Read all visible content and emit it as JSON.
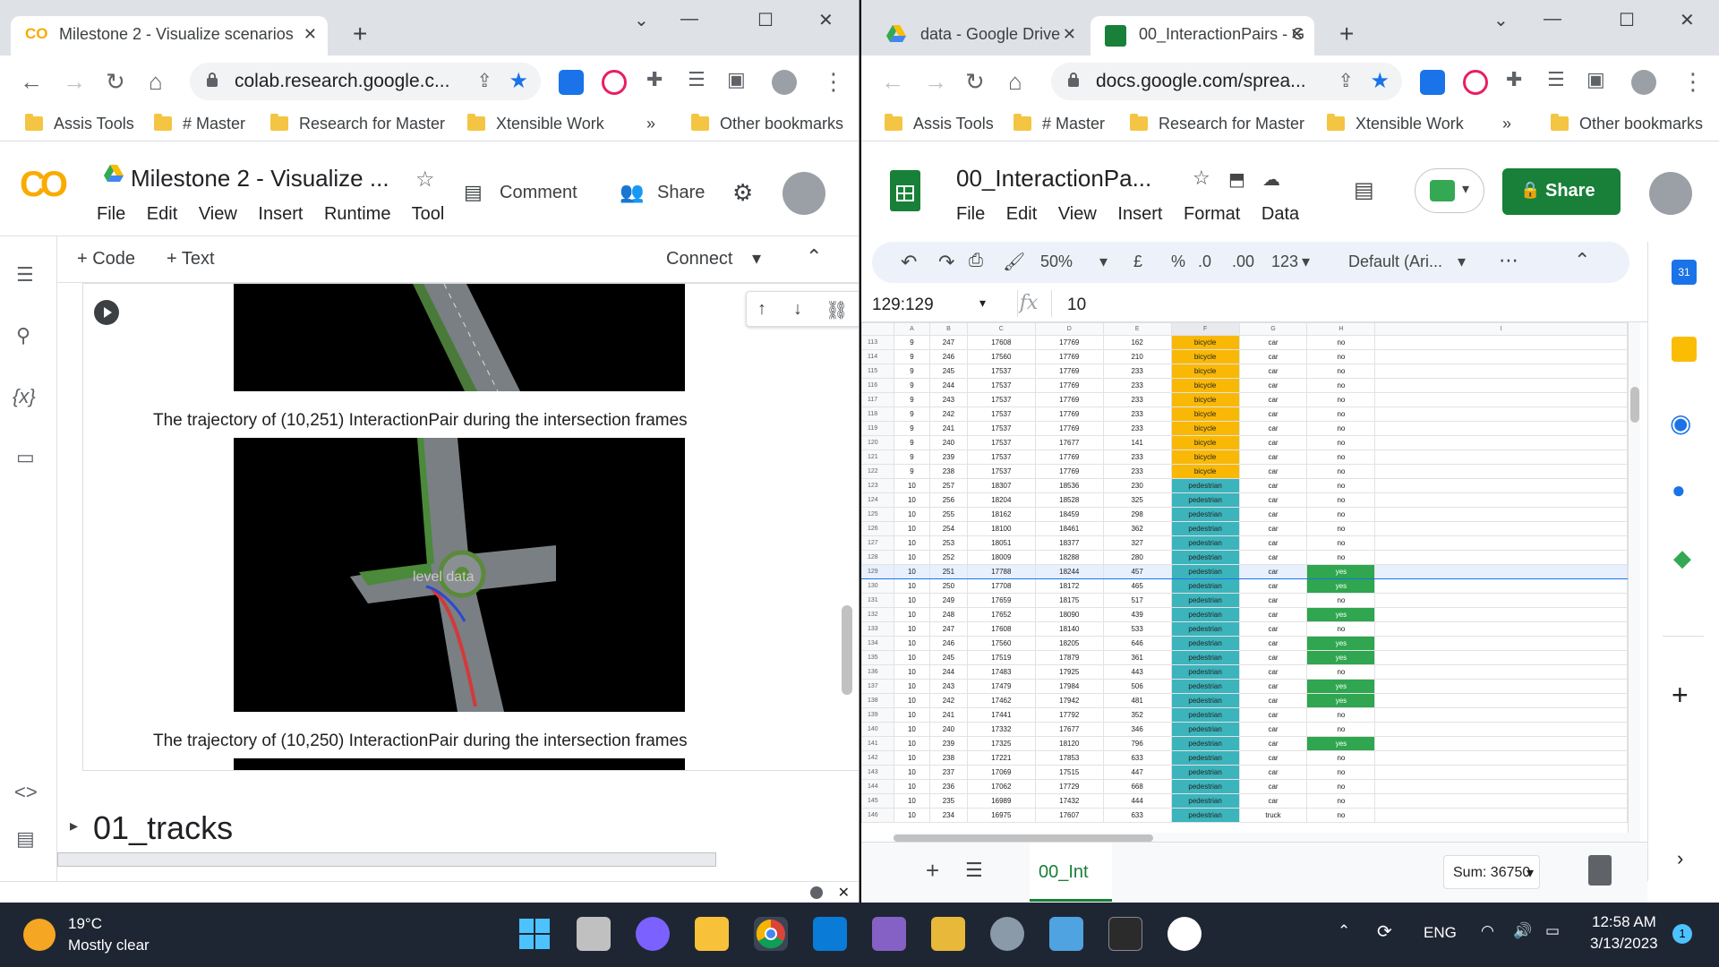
{
  "left_window": {
    "tab_title": "Milestone 2 - Visualize scenarios",
    "url": "colab.research.google.c...",
    "bookmarks": [
      "Assis Tools",
      "# Master",
      "Research for Master",
      "Xtensible Work"
    ],
    "more_bookmarks": "»",
    "other_bookmarks": "Other bookmarks",
    "notebook_title": "Milestone 2 - Visualize ...",
    "menu": [
      "File",
      "Edit",
      "View",
      "Insert",
      "Runtime",
      "Tool"
    ],
    "comment_label": "Comment",
    "share_label": "Share",
    "add_code": "+ Code",
    "add_text": "+ Text",
    "connect_label": "Connect",
    "caption1": "The trajectory of (10,251) InteractionPair during the intersection frames",
    "caption2": "The trajectory of (10,250) InteractionPair during the intersection frames",
    "watermark": "level data",
    "section_title": "01_tracks"
  },
  "right_window": {
    "tab1_title": "data - Google Drive",
    "tab2_title": "00_InteractionPairs - G",
    "url": "docs.google.com/sprea...",
    "bookmarks": [
      "Assis Tools",
      "# Master",
      "Research for Master",
      "Xtensible Work"
    ],
    "more_bookmarks": "»",
    "other_bookmarks": "Other bookmarks",
    "doc_title": "00_InteractionPa...",
    "menu": [
      "File",
      "Edit",
      "View",
      "Insert",
      "Format",
      "Data"
    ],
    "share_label": "Share",
    "zoom": "50%",
    "currency": "£",
    "percent": "%",
    "dec_dec": ".0",
    "dec_inc": ".00",
    "num_fmt": "123",
    "font": "Default (Ari...",
    "cell_ref": "129:129",
    "fx": "fx",
    "formula_value": "10",
    "sheet_tab": "00_Int",
    "sum": "Sum: 36750",
    "columns": [
      "A",
      "B",
      "C",
      "D",
      "E",
      "F",
      "G",
      "H",
      "I"
    ],
    "rows": [
      [
        "113",
        "9",
        "247",
        "17608",
        "17769",
        "162",
        "bicycle",
        "car",
        "no"
      ],
      [
        "114",
        "9",
        "246",
        "17560",
        "17769",
        "210",
        "bicycle",
        "car",
        "no"
      ],
      [
        "115",
        "9",
        "245",
        "17537",
        "17769",
        "233",
        "bicycle",
        "car",
        "no"
      ],
      [
        "116",
        "9",
        "244",
        "17537",
        "17769",
        "233",
        "bicycle",
        "car",
        "no"
      ],
      [
        "117",
        "9",
        "243",
        "17537",
        "17769",
        "233",
        "bicycle",
        "car",
        "no"
      ],
      [
        "118",
        "9",
        "242",
        "17537",
        "17769",
        "233",
        "bicycle",
        "car",
        "no"
      ],
      [
        "119",
        "9",
        "241",
        "17537",
        "17769",
        "233",
        "bicycle",
        "car",
        "no"
      ],
      [
        "120",
        "9",
        "240",
        "17537",
        "17677",
        "141",
        "bicycle",
        "car",
        "no"
      ],
      [
        "121",
        "9",
        "239",
        "17537",
        "17769",
        "233",
        "bicycle",
        "car",
        "no"
      ],
      [
        "122",
        "9",
        "238",
        "17537",
        "17769",
        "233",
        "bicycle",
        "car",
        "no"
      ],
      [
        "123",
        "10",
        "257",
        "18307",
        "18536",
        "230",
        "pedestrian",
        "car",
        "no"
      ],
      [
        "124",
        "10",
        "256",
        "18204",
        "18528",
        "325",
        "pedestrian",
        "car",
        "no"
      ],
      [
        "125",
        "10",
        "255",
        "18162",
        "18459",
        "298",
        "pedestrian",
        "car",
        "no"
      ],
      [
        "126",
        "10",
        "254",
        "18100",
        "18461",
        "362",
        "pedestrian",
        "car",
        "no"
      ],
      [
        "127",
        "10",
        "253",
        "18051",
        "18377",
        "327",
        "pedestrian",
        "car",
        "no"
      ],
      [
        "128",
        "10",
        "252",
        "18009",
        "18288",
        "280",
        "pedestrian",
        "car",
        "no"
      ],
      [
        "129",
        "10",
        "251",
        "17788",
        "18244",
        "457",
        "pedestrian",
        "car",
        "yes"
      ],
      [
        "130",
        "10",
        "250",
        "17708",
        "18172",
        "465",
        "pedestrian",
        "car",
        "yes"
      ],
      [
        "131",
        "10",
        "249",
        "17659",
        "18175",
        "517",
        "pedestrian",
        "car",
        "no"
      ],
      [
        "132",
        "10",
        "248",
        "17652",
        "18090",
        "439",
        "pedestrian",
        "car",
        "yes"
      ],
      [
        "133",
        "10",
        "247",
        "17608",
        "18140",
        "533",
        "pedestrian",
        "car",
        "no"
      ],
      [
        "134",
        "10",
        "246",
        "17560",
        "18205",
        "646",
        "pedestrian",
        "car",
        "yes"
      ],
      [
        "135",
        "10",
        "245",
        "17519",
        "17879",
        "361",
        "pedestrian",
        "car",
        "yes"
      ],
      [
        "136",
        "10",
        "244",
        "17483",
        "17925",
        "443",
        "pedestrian",
        "car",
        "no"
      ],
      [
        "137",
        "10",
        "243",
        "17479",
        "17984",
        "506",
        "pedestrian",
        "car",
        "yes"
      ],
      [
        "138",
        "10",
        "242",
        "17462",
        "17942",
        "481",
        "pedestrian",
        "car",
        "yes"
      ],
      [
        "139",
        "10",
        "241",
        "17441",
        "17792",
        "352",
        "pedestrian",
        "car",
        "no"
      ],
      [
        "140",
        "10",
        "240",
        "17332",
        "17677",
        "346",
        "pedestrian",
        "car",
        "no"
      ],
      [
        "141",
        "10",
        "239",
        "17325",
        "18120",
        "796",
        "pedestrian",
        "car",
        "yes"
      ],
      [
        "142",
        "10",
        "238",
        "17221",
        "17853",
        "633",
        "pedestrian",
        "car",
        "no"
      ],
      [
        "143",
        "10",
        "237",
        "17069",
        "17515",
        "447",
        "pedestrian",
        "car",
        "no"
      ],
      [
        "144",
        "10",
        "236",
        "17062",
        "17729",
        "668",
        "pedestrian",
        "car",
        "no"
      ],
      [
        "145",
        "10",
        "235",
        "16989",
        "17432",
        "444",
        "pedestrian",
        "car",
        "no"
      ],
      [
        "146",
        "10",
        "234",
        "16975",
        "17607",
        "633",
        "pedestrian",
        "truck",
        "no"
      ]
    ]
  },
  "taskbar": {
    "temperature": "19°C",
    "weather": "Mostly clear",
    "language": "ENG",
    "time": "12:58 AM",
    "date": "3/13/2023",
    "notifications": "1"
  },
  "colors": {
    "accent_blue": "#1a73e8",
    "sheets_green": "#188038",
    "bicycle": "#f9b806",
    "pedestrian": "#3cb4bc",
    "yes": "#2fa64f"
  }
}
